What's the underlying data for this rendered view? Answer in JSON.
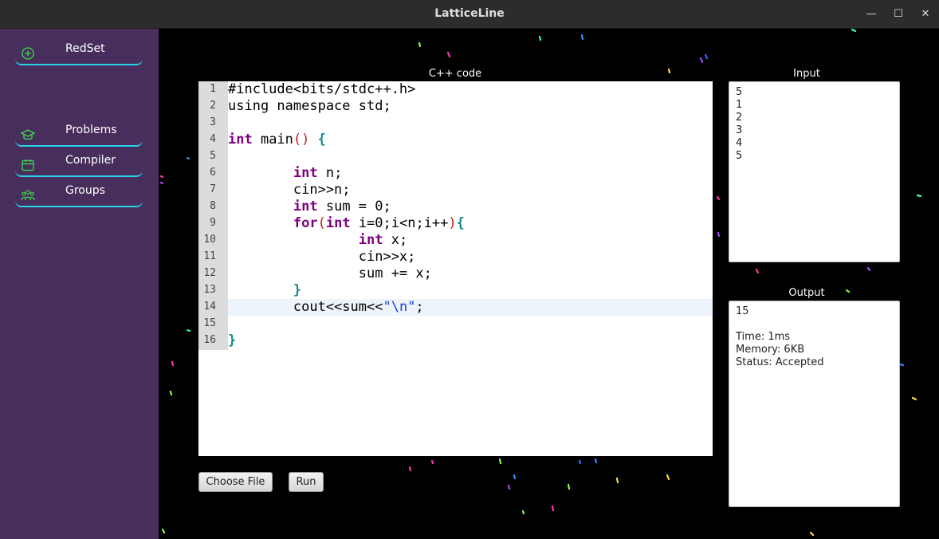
{
  "window": {
    "title": "LatticeLine",
    "controls": {
      "minimize": "—",
      "maximize": "☐",
      "close": "✕"
    }
  },
  "sidebar": {
    "items": [
      {
        "label": "RedSet",
        "icon": "plus-circle-icon"
      },
      {
        "label": "Problems",
        "icon": "graduation-cap-icon"
      },
      {
        "label": "Compiler",
        "icon": "calendar-icon"
      },
      {
        "label": "Groups",
        "icon": "users-icon"
      }
    ],
    "accent_color": "#27d4ea",
    "icon_color": "#3ddc4a",
    "background": "#482e5c"
  },
  "editor": {
    "label": "C++ code",
    "line_numbers": [
      "1",
      "2",
      "3",
      "4",
      "5",
      "6",
      "7",
      "8",
      "9",
      "10",
      "11",
      "12",
      "13",
      "14",
      "15",
      "16"
    ],
    "lines": [
      "#include<bits/stdc++.h>",
      "using namespace std;",
      "",
      "int main() {",
      "",
      "        int n;",
      "        cin>>n;",
      "        int sum = 0;",
      "        for(int i=0;i<n;i++){",
      "                int x;",
      "                cin>>x;",
      "                sum += x;",
      "        }",
      "        cout<<sum<<\"\\n\";",
      "",
      "}"
    ],
    "active_line": 14
  },
  "input": {
    "label": "Input",
    "value": "5\n1\n2\n3\n4\n5"
  },
  "output": {
    "label": "Output",
    "value": "15\n\nTime: 1ms\nMemory: 6KB\nStatus: Accepted"
  },
  "buttons": {
    "choose_file": "Choose File",
    "run": "Run"
  }
}
